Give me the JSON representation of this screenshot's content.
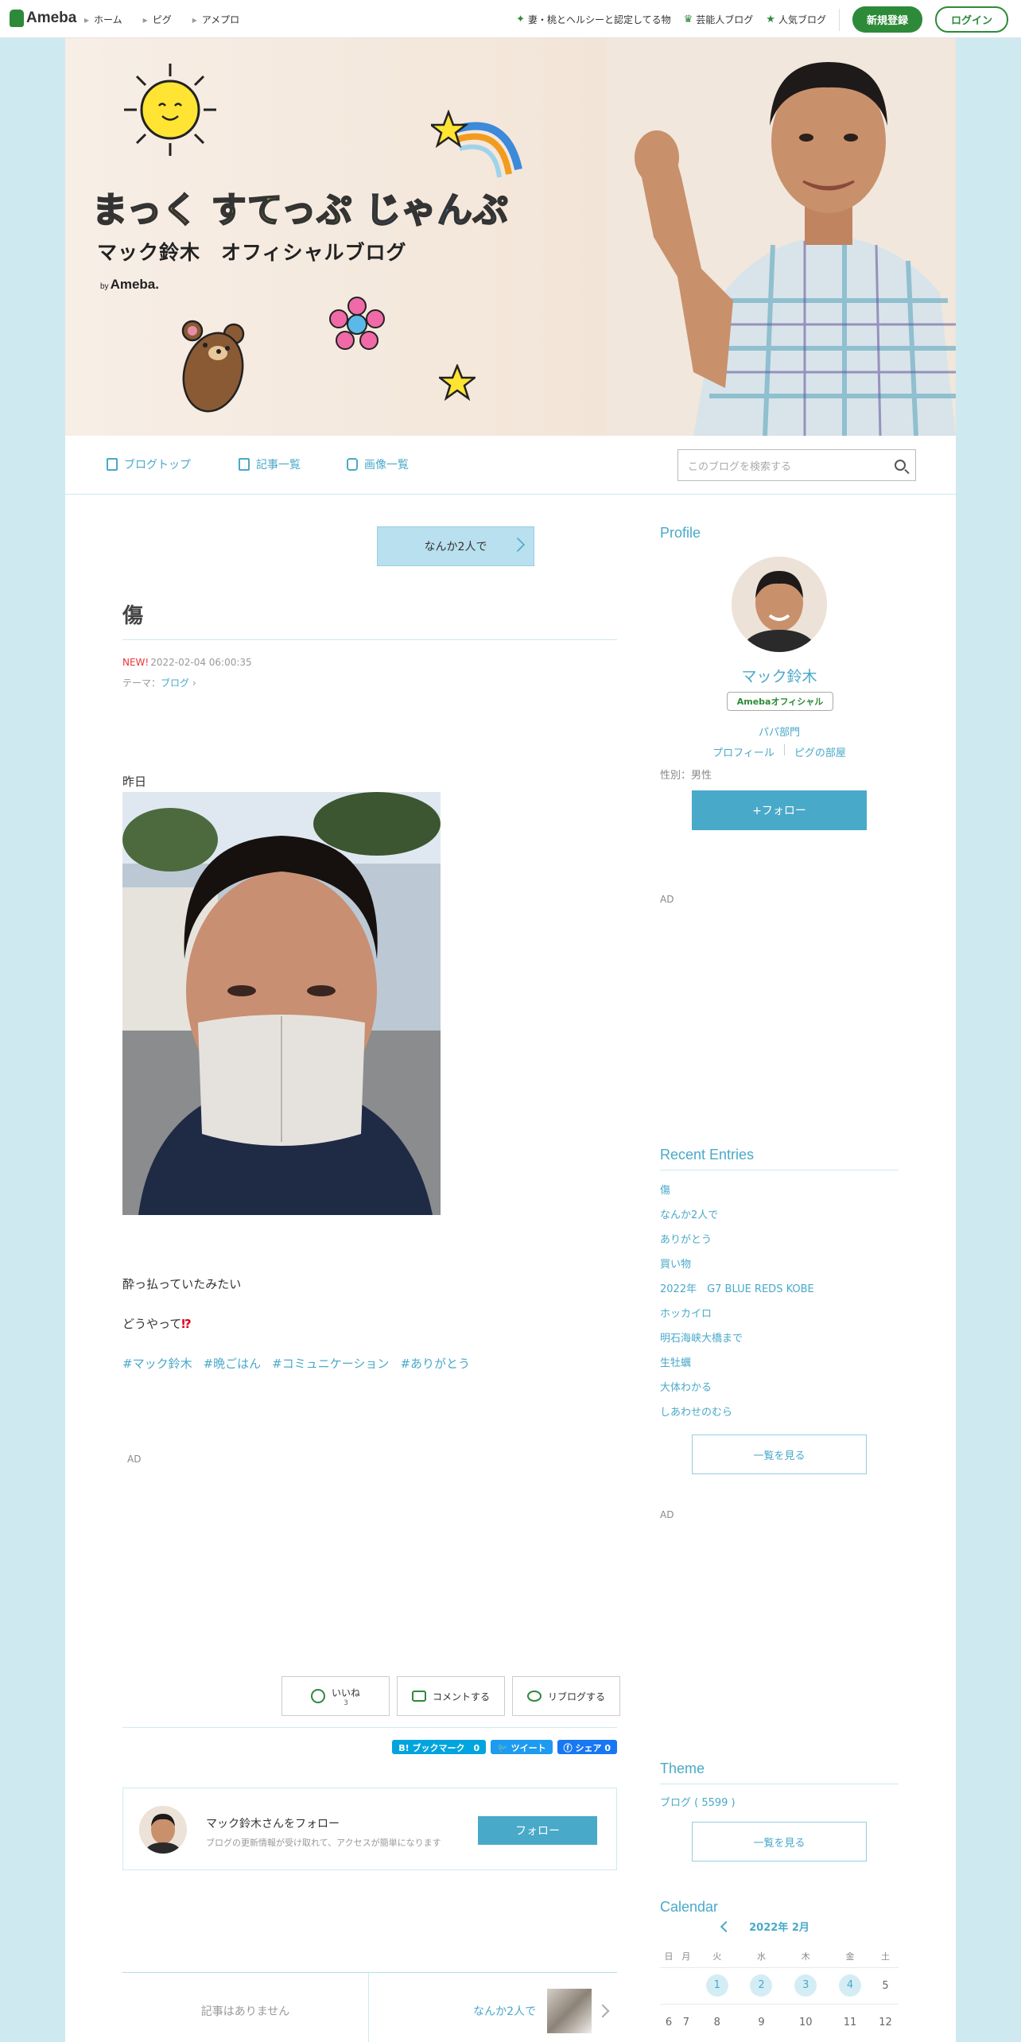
{
  "topbar": {
    "logo": "Ameba",
    "nav": [
      "ホーム",
      "ピグ",
      "アメプロ"
    ],
    "links": [
      {
        "label": "妻・桃とヘルシーと認定してる物",
        "icon": "sparkle-icon"
      },
      {
        "label": "芸能人ブログ",
        "icon": "crown-icon"
      },
      {
        "label": "人気ブログ",
        "icon": "star-icon"
      }
    ],
    "register": "新規登録",
    "login": "ログイン"
  },
  "header": {
    "title_parts": [
      "まっく",
      "すてっぷ",
      "じゃんぷ"
    ],
    "subtitle": "マック鈴木　オフィシャルブログ",
    "by": "by",
    "brand": "Ameba."
  },
  "blognav": {
    "items": [
      "ブログトップ",
      "記事一覧",
      "画像一覧"
    ],
    "search_placeholder": "このブログを検索する"
  },
  "article": {
    "prev_top": "なんか2人で",
    "title": "傷",
    "new": "NEW!",
    "date": "2022-02-04 06:00:35",
    "theme_label": "テーマ：",
    "theme": "ブログ",
    "p1": "昨日",
    "p2": "酔っ払っていたみたい",
    "p3": "どうやって",
    "p3_mark": "⁉",
    "tags": [
      "#マック鈴木",
      "#晩ごはん",
      "#コミュニケーション",
      "#ありがとう"
    ],
    "ad": "AD"
  },
  "actions": {
    "like": "いいね",
    "like_count": "3",
    "comment": "コメントする",
    "reblog": "リブログする"
  },
  "share": {
    "hatena": "B! ブックマーク　0",
    "tweet": "ツイート",
    "facebook": "シェア 0"
  },
  "follow_box": {
    "name": "マック鈴木さんをフォロー",
    "desc": "ブログの更新情報が受け取れて、アクセスが簡単になります",
    "button": "フォロー"
  },
  "pager": {
    "prev": "記事はありません",
    "next": "なんか2人で"
  },
  "sidebar": {
    "profile": {
      "heading": "Profile",
      "name": "マック鈴木",
      "badge": "Amebaオフィシャル",
      "category": "パパ部門",
      "link1": "プロフィール",
      "link2": "ピグの部屋",
      "gender": "性別：男性",
      "follow": "+フォロー"
    },
    "ad1": "AD",
    "recent": {
      "heading": "Recent Entries",
      "items": [
        "傷",
        "なんか2人で",
        "ありがとう",
        "買い物",
        "2022年　G7 BLUE REDS KOBE",
        "ホッカイロ",
        "明石海峡大橋まで",
        "生牡蠣",
        "大体わかる",
        "しあわせのむら"
      ],
      "more": "一覧を見る"
    },
    "ad2": "AD",
    "theme": {
      "heading": "Theme",
      "item": "ブログ ( 5599 )",
      "more": "一覧を見る"
    },
    "calendar": {
      "heading": "Calendar",
      "month": "2022年 2月",
      "weekdays": [
        "日",
        "月",
        "火",
        "水",
        "木",
        "金",
        "土"
      ],
      "rows": [
        [
          "",
          "",
          "1",
          "2",
          "3",
          "4",
          "5"
        ],
        [
          "6",
          "7",
          "8",
          "9",
          "10",
          "11",
          "12"
        ]
      ],
      "posted_days": [
        "1",
        "2",
        "3",
        "4"
      ]
    }
  }
}
